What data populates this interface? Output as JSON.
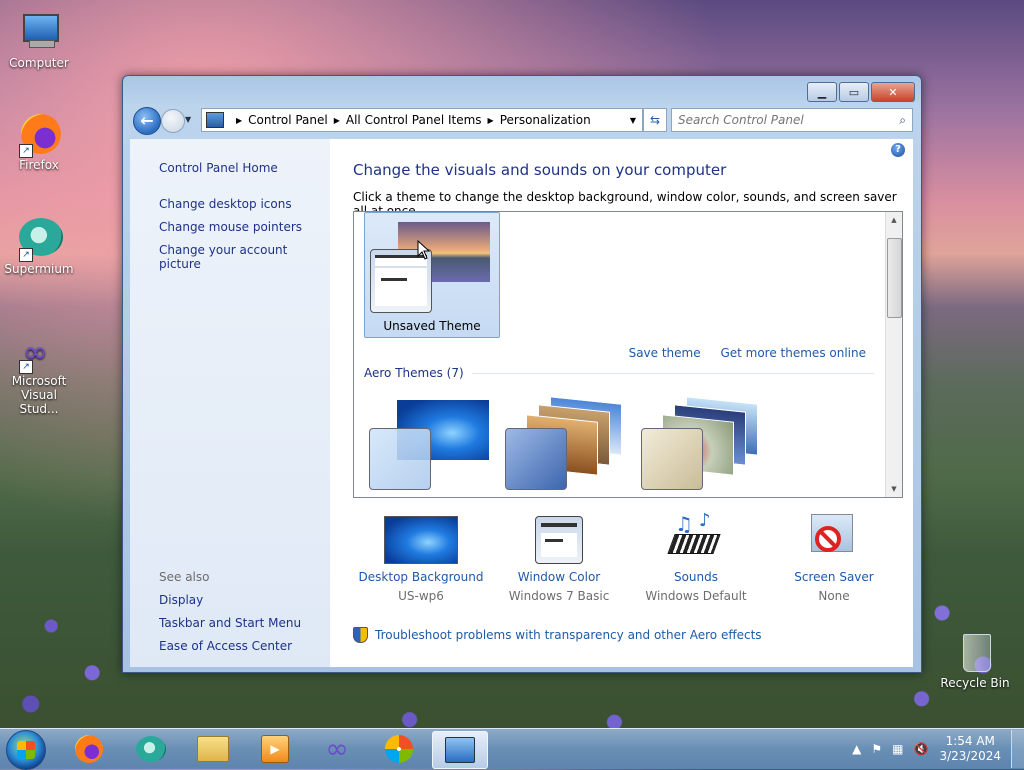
{
  "desktop": {
    "icons": [
      {
        "label": "Computer"
      },
      {
        "label": "Firefox"
      },
      {
        "label": "Supermium"
      },
      {
        "label": "Microsoft Visual Stud..."
      },
      {
        "label": "Recycle Bin"
      }
    ]
  },
  "window": {
    "address": {
      "crumbs": [
        "Control Panel",
        "All Control Panel Items",
        "Personalization"
      ]
    },
    "search": {
      "placeholder": "Search Control Panel"
    },
    "sidebar": {
      "home": "Control Panel Home",
      "links": [
        "Change desktop icons",
        "Change mouse pointers",
        "Change your account picture"
      ],
      "see_also_label": "See also",
      "see_also": [
        "Display",
        "Taskbar and Start Menu",
        "Ease of Access Center"
      ]
    },
    "main": {
      "title": "Change the visuals and sounds on your computer",
      "subtitle": "Click a theme to change the desktop background, window color, sounds, and screen saver all at once.",
      "selected_theme": "Unsaved Theme",
      "save_theme": "Save theme",
      "get_more": "Get more themes online",
      "group_header": "Aero Themes (7)",
      "settings": [
        {
          "label": "Desktop Background",
          "value": "US-wp6"
        },
        {
          "label": "Window Color",
          "value": "Windows 7 Basic"
        },
        {
          "label": "Sounds",
          "value": "Windows Default"
        },
        {
          "label": "Screen Saver",
          "value": "None"
        }
      ],
      "troubleshoot": "Troubleshoot problems with transparency and other Aero effects"
    }
  },
  "taskbar": {
    "clock_time": "1:54 AM",
    "clock_date": "3/23/2024"
  },
  "colors": {
    "link": "#1e5aa8",
    "heading": "#1e3287"
  }
}
